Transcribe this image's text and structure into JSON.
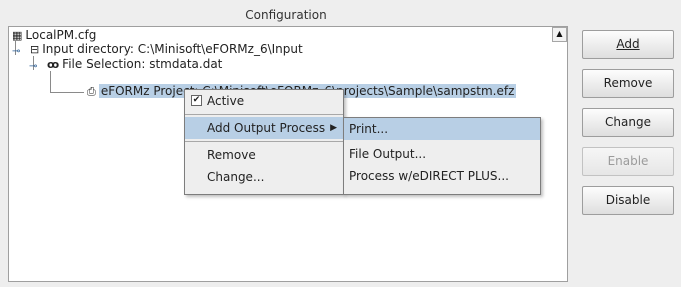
{
  "panel": {
    "title": "Configuration"
  },
  "tree": {
    "root": {
      "label": "LocalPM.cfg",
      "icon": "config-file-icon"
    },
    "input_dir": {
      "label": "Input directory: C:\\Minisoft\\eFORMz_6\\Input",
      "icon": "folder-icon"
    },
    "file_selection": {
      "label": "File Selection: stmdata.dat",
      "icon": "binoculars-icon"
    },
    "project": {
      "label": "eFORMz Project: C:\\Minisoft\\eFORMz_6\\projects\\Sample\\sampstm.efz",
      "icon": "printer-icon"
    }
  },
  "context_menu": {
    "active_label": "Active",
    "active_checked": true,
    "add_output_label": "Add Output Process",
    "remove_label": "Remove",
    "change_label": "Change..."
  },
  "submenu": {
    "items": [
      "Print...",
      "File Output...",
      "Process w/eDIRECT PLUS..."
    ]
  },
  "buttons": {
    "add": "Add",
    "remove": "Remove",
    "change": "Change",
    "enable": "Enable",
    "disable": "Disable"
  }
}
